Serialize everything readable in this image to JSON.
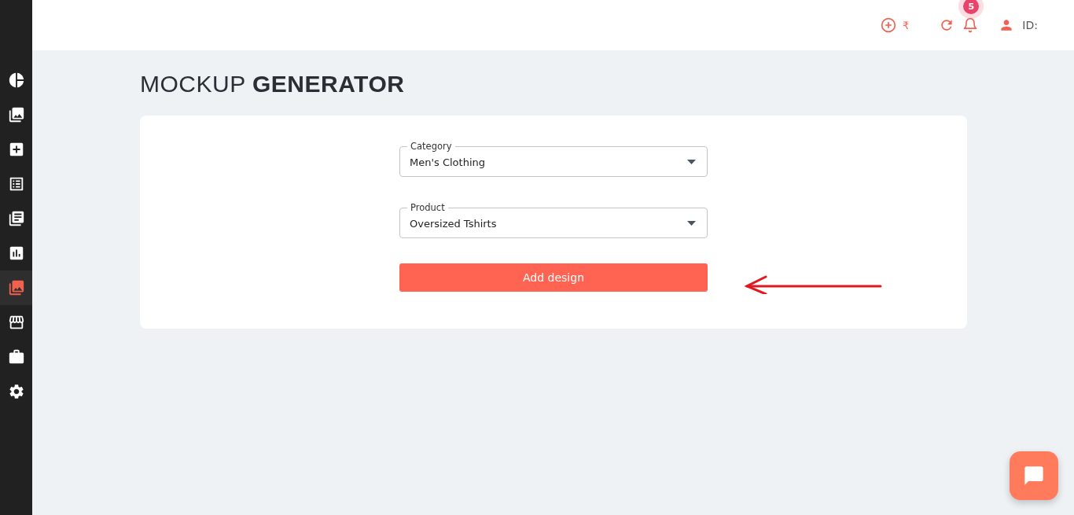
{
  "sidebar": {
    "items": [
      {
        "kind": "pie",
        "selected": false
      },
      {
        "kind": "gallery",
        "selected": false
      },
      {
        "kind": "add",
        "selected": false
      },
      {
        "kind": "list",
        "selected": false
      },
      {
        "kind": "library",
        "selected": false
      },
      {
        "kind": "chart",
        "selected": false
      },
      {
        "kind": "gallery",
        "selected": true
      },
      {
        "kind": "store",
        "selected": false
      },
      {
        "kind": "briefcase",
        "selected": false
      },
      {
        "kind": "settings",
        "selected": false
      }
    ]
  },
  "topbar": {
    "wallet": "₹",
    "notifications": "5",
    "user_id": "ID:"
  },
  "title": "MOCKUP **GENERATOR**",
  "form": {
    "fields": [
      {
        "label": "Category",
        "value": "Men's Clothing"
      },
      {
        "label": "Product",
        "value": "Oversized Tshirts"
      }
    ],
    "button": "Add design"
  }
}
